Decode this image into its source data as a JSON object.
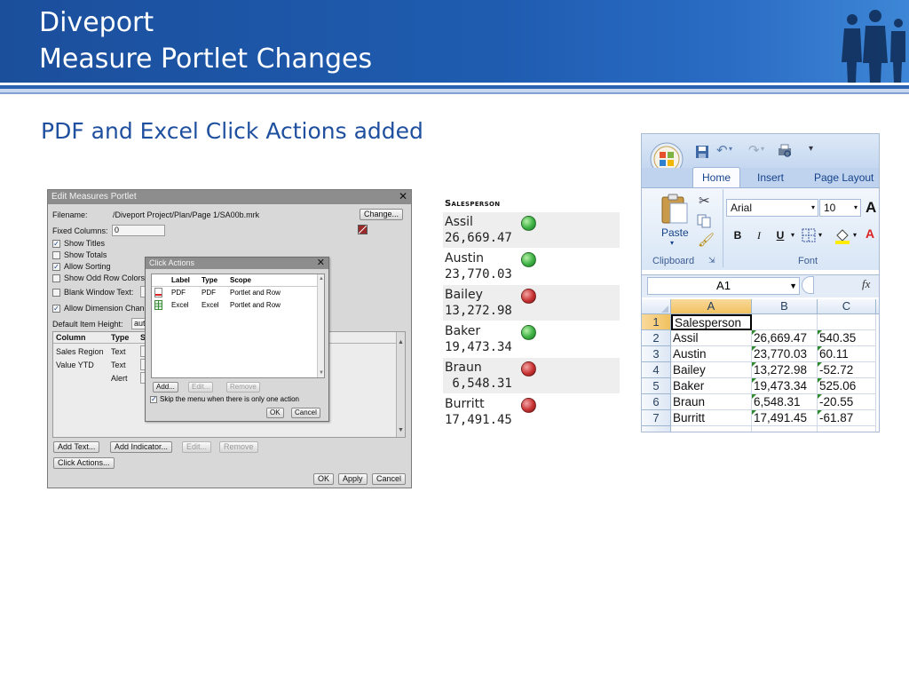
{
  "slide": {
    "title_line1": "Diveport",
    "title_line2": "Measure Portlet Changes",
    "subtitle": "PDF and Excel Click Actions added"
  },
  "portlet": {
    "title": "Edit Measures Portlet",
    "filename_label": "Filename:",
    "filename_value": "/Diveport Project/Plan/Page 1/SA00b.mrk",
    "change_button": "Change...",
    "fixed_columns_label": "Fixed Columns:",
    "fixed_columns_value": "0",
    "options": [
      {
        "label": "Show Titles",
        "checked": true
      },
      {
        "label": "Show Totals",
        "checked": false
      },
      {
        "label": "Allow Sorting",
        "checked": true
      },
      {
        "label": "Show Odd Row Colors",
        "checked": false
      },
      {
        "label": "Blank Window Text:",
        "checked": false
      },
      {
        "label": "Allow Dimension Changes",
        "checked": true
      }
    ],
    "default_item_height_label": "Default Item Height:",
    "default_item_height_value": "auto",
    "columns_header": {
      "column": "Column",
      "type": "Type",
      "s": "S"
    },
    "columns": [
      {
        "column": "Sales Region",
        "type": "Text"
      },
      {
        "column": "Value YTD",
        "type": "Text"
      },
      {
        "column": "",
        "type": "Alert"
      }
    ],
    "buttons": {
      "add_text": "Add Text...",
      "add_indicator": "Add Indicator...",
      "edit": "Edit...",
      "remove": "Remove",
      "click_actions": "Click Actions...",
      "ok": "OK",
      "apply": "Apply",
      "cancel": "Cancel"
    }
  },
  "click_actions": {
    "title": "Click Actions",
    "headers": {
      "label": "Label",
      "type": "Type",
      "scope": "Scope"
    },
    "rows": [
      {
        "label": "PDF",
        "type": "PDF",
        "scope": "Portlet and Row",
        "icon": "pdf-file-icon"
      },
      {
        "label": "Excel",
        "type": "Excel",
        "scope": "Portlet and Row",
        "icon": "excel-file-icon"
      }
    ],
    "add": "Add...",
    "edit": "Edit...",
    "remove": "Remove",
    "skip_label": "Skip the menu when there is only one action",
    "skip_checked": true,
    "ok": "OK",
    "cancel": "Cancel"
  },
  "salesperson_list": {
    "header": "Salesperson",
    "rows": [
      {
        "name": "Assil",
        "value": "26,669.47",
        "status": "green"
      },
      {
        "name": "Austin",
        "value": "23,770.03",
        "status": "green"
      },
      {
        "name": "Bailey",
        "value": "13,272.98",
        "status": "red"
      },
      {
        "name": "Baker",
        "value": "19,473.34",
        "status": "green"
      },
      {
        "name": "Braun",
        "value": " 6,548.31",
        "status": "red"
      },
      {
        "name": "Burritt",
        "value": "17,491.45",
        "status": "red"
      }
    ],
    "colors": {
      "green": "#3cb043",
      "red": "#c83232"
    }
  },
  "excel": {
    "tabs": {
      "home": "Home",
      "insert": "Insert",
      "page_layout": "Page Layout"
    },
    "paste_label": "Paste",
    "clipboard_label": "Clipboard",
    "font_label": "Font",
    "font_name": "Arial",
    "font_size": "10",
    "bold": "B",
    "italic": "I",
    "underline": "U",
    "name_box": "A1",
    "fx": "fx",
    "column_headers": [
      "A",
      "B",
      "C"
    ],
    "rows": [
      {
        "num": "1",
        "a": "Salesperson",
        "b": "",
        "c": ""
      },
      {
        "num": "2",
        "a": "Assil",
        "b": "26,669.47",
        "c": "540.35"
      },
      {
        "num": "3",
        "a": "Austin",
        "b": "23,770.03",
        "c": "60.11"
      },
      {
        "num": "4",
        "a": "Bailey",
        "b": "13,272.98",
        "c": "-52.72"
      },
      {
        "num": "5",
        "a": "Baker",
        "b": "19,473.34",
        "c": "525.06"
      },
      {
        "num": "6",
        "a": "Braun",
        "b": "6,548.31",
        "c": "-20.55"
      },
      {
        "num": "7",
        "a": "Burritt",
        "b": "17,491.45",
        "c": "-61.87"
      }
    ]
  }
}
